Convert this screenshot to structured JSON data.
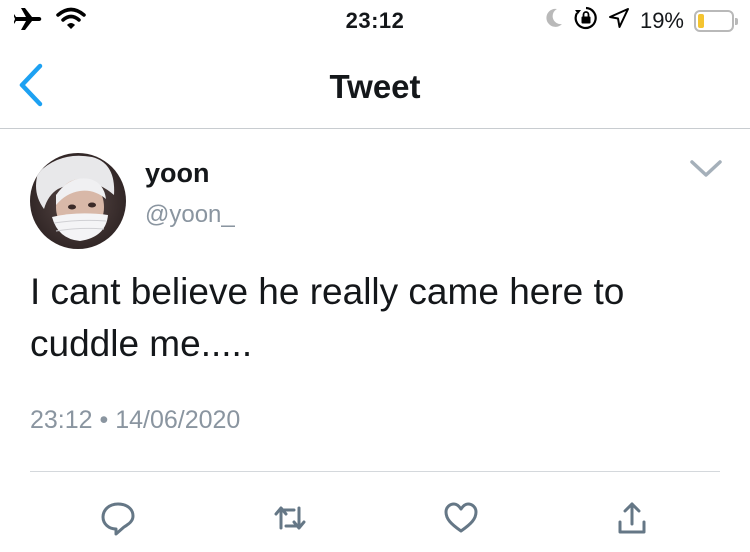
{
  "status_bar": {
    "time": "23:12",
    "battery_percent_text": "19%",
    "battery_level": 0.19,
    "icons": [
      "airplane-icon",
      "wifi-icon",
      "moon-icon",
      "rotation-lock-icon",
      "location-icon",
      "battery-icon"
    ]
  },
  "nav": {
    "title": "Tweet",
    "back_icon": "chevron-left-icon"
  },
  "tweet": {
    "display_name": "yoon",
    "handle": "@yoon_",
    "text": "I cant believe he really came here to cuddle me.....",
    "timestamp": "23:12 • 14/06/2020"
  },
  "actions": [
    {
      "name": "reply",
      "icon": "reply-icon"
    },
    {
      "name": "retweet",
      "icon": "retweet-icon"
    },
    {
      "name": "like",
      "icon": "heart-icon"
    },
    {
      "name": "share",
      "icon": "share-icon"
    }
  ],
  "colors": {
    "accent": "#1da1f2",
    "secondary_text": "#8a95a0",
    "icon_gray": "#657786",
    "battery_fill": "#f4c430"
  }
}
